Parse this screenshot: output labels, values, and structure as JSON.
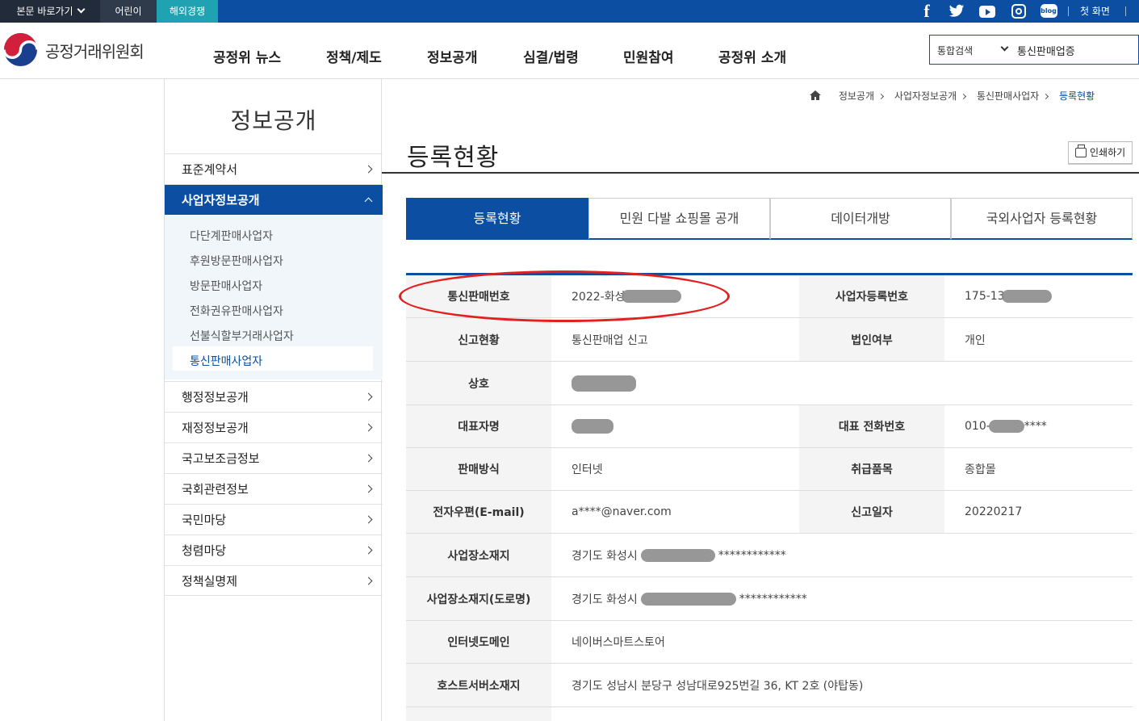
{
  "topbar": {
    "skip_label": "본문 바로가기",
    "kids_label": "어린이",
    "overseas_label": "해외경쟁",
    "facebook_glyph": "f",
    "blog_glyph": "blog",
    "home_label": "첫 화면"
  },
  "header": {
    "org_name": "공정거래위원회",
    "nav": [
      "공정위 뉴스",
      "정책/제도",
      "정보공개",
      "심결/법령",
      "민원참여",
      "공정위 소개"
    ],
    "search_scope": "통합검색",
    "search_value": "통신판매업증"
  },
  "sidebar": {
    "title": "정보공개",
    "items": [
      "표준계약서",
      "사업자정보공개",
      "행정정보공개",
      "재정정보공개",
      "국고보조금정보",
      "국회관련정보",
      "국민마당",
      "청렴마당",
      "정책실명제"
    ],
    "sub_items": [
      "다단계판매사업자",
      "후원방문판매사업자",
      "방문판매사업자",
      "전화권유판매사업자",
      "선불식할부거래사업자",
      "통신판매사업자"
    ]
  },
  "breadcrumb": [
    "정보공개",
    "사업자정보공개",
    "통신판매사업자",
    "등록현황"
  ],
  "page": {
    "title": "등록현황",
    "print_label": "인쇄하기",
    "tabs": [
      "등록현황",
      "민원 다발 쇼핑몰 공개",
      "데이터개방",
      "국외사업자 등록현황"
    ]
  },
  "detail": {
    "rows": [
      {
        "label1": "통신판매번호",
        "value1": "2022-화성",
        "label2": "사업자등록번호",
        "value2": "175-13"
      },
      {
        "label1": "신고현황",
        "value1": "통신판매업 신고",
        "label2": "법인여부",
        "value2": "개인"
      },
      {
        "label1": "상호",
        "value1": ""
      },
      {
        "label1": "대표자명",
        "value1": "",
        "label2": "대표 전화번호",
        "value2": "010-",
        "value2_tail": "****"
      },
      {
        "label1": "판매방식",
        "value1": "인터넷",
        "label2": "취급품목",
        "value2": "종합몰"
      },
      {
        "label1": "전자우편(E-mail)",
        "value1": "a****@naver.com",
        "label2": "신고일자",
        "value2": "20220217"
      },
      {
        "label1": "사업장소재지",
        "value1": "경기도 화성시",
        "value1_tail": "************"
      },
      {
        "label1": "사업장소재지(도로명)",
        "value1": "경기도 화성시",
        "value1_tail": "************"
      },
      {
        "label1": "인터넷도메인",
        "value1": "네이버스마트스토어"
      },
      {
        "label1": "호스트서버소재지",
        "value1": "경기도 성남시 분당구 성남대로925번길 36, KT 2호 (야탑동)"
      }
    ]
  },
  "colors": {
    "brand": "#0b4ea2",
    "highlight_oval": "#e22020"
  }
}
